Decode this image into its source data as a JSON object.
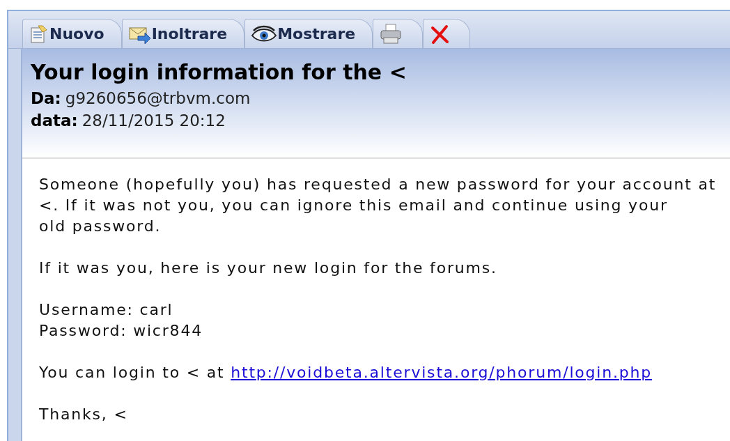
{
  "toolbar": {
    "tabs": [
      {
        "kind": "new",
        "label": "Nuovo"
      },
      {
        "kind": "forward",
        "label": "Inoltrare"
      },
      {
        "kind": "view",
        "label": "Mostrare"
      },
      {
        "kind": "print"
      },
      {
        "kind": "delete"
      }
    ]
  },
  "header": {
    "subject": "Your login information for the <",
    "from_label": "Da:",
    "from": "g9260656@trbvm.com",
    "date_label": "data:",
    "date": "28/11/2015 20:12"
  },
  "body": [
    {
      "kind": "text",
      "lines": [
        "Someone (hopefully you) has requested a new password for your account at",
        "<. If it was not you, you can ignore this email and continue using your",
        "old password."
      ]
    },
    {
      "kind": "text",
      "lines": [
        "If it was you, here is your new login for the forums."
      ]
    },
    {
      "kind": "text",
      "lines": [
        "Username: carl",
        "Password: wicr844"
      ]
    },
    {
      "kind": "link",
      "text": "You can login to < at ",
      "link": "http://voidbeta.altervista.org/phorum/login.php"
    },
    {
      "kind": "text",
      "lines": [
        "Thanks, <"
      ]
    }
  ]
}
